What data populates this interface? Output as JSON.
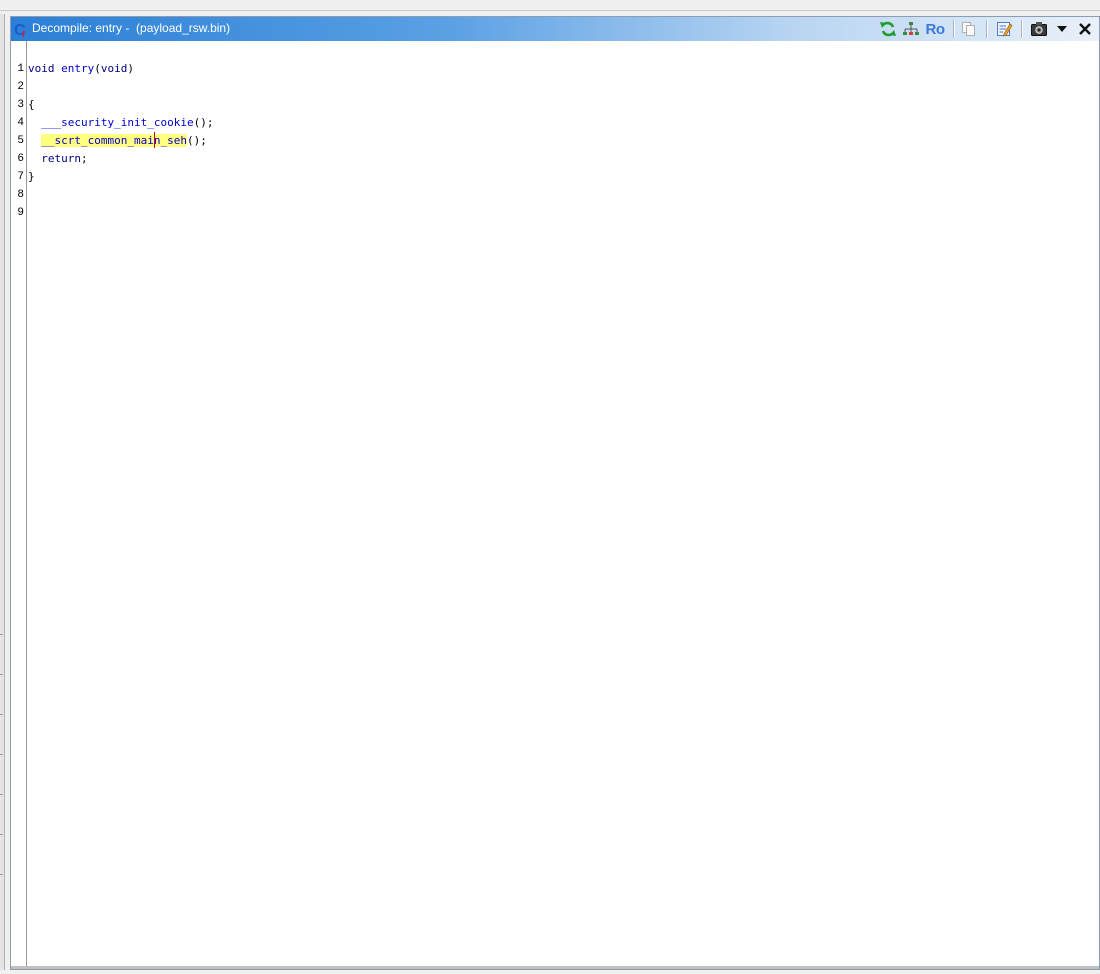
{
  "window": {
    "title": "Decompile: entry -  (payload_rsw.bin)",
    "readonly_label": "Ro"
  },
  "toolbar": {
    "icons": [
      "refresh-icon",
      "function-graph-icon",
      "read-only-label",
      "copy-icon",
      "edit-signature-icon",
      "snapshot-icon",
      "menu-dropdown-icon",
      "close-icon"
    ]
  },
  "code": {
    "lines": [
      {
        "num": "1",
        "text": ""
      },
      {
        "num": "2",
        "kw1": "void",
        "fn": "entry",
        "p1": "(",
        "kw2": "void",
        "p2": ")"
      },
      {
        "num": "3",
        "text": ""
      },
      {
        "num": "4",
        "text": "{"
      },
      {
        "num": "5",
        "fn": "___security_init_cookie",
        "p": "();"
      },
      {
        "num": "6",
        "fn_before_caret": "__scrt_common_mai",
        "fn_after_caret": "n_seh",
        "p": "();"
      },
      {
        "num": "7",
        "kw": "return",
        "p": ";"
      },
      {
        "num": "8",
        "text": "}"
      },
      {
        "num": "9",
        "text": ""
      }
    ]
  },
  "colors": {
    "keyword": "#00007f",
    "function": "#0000cc",
    "highlight": "#ffff80",
    "caret": "#d00000",
    "titlebar_start": "#2b7fd6"
  }
}
